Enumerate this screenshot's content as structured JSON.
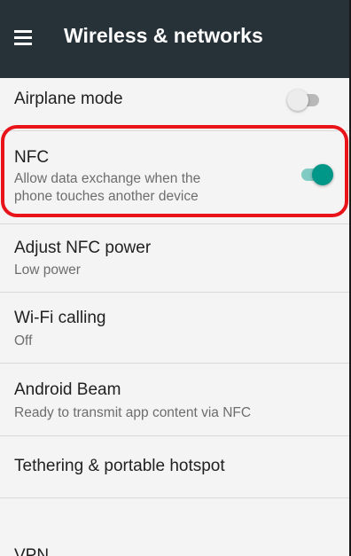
{
  "toolbar": {
    "title": "Wireless & networks",
    "menu_icon": "hamburger-menu-icon",
    "background": "#263238"
  },
  "items": [
    {
      "title": "Airplane mode",
      "summary": "",
      "toggle": "off"
    },
    {
      "title": "NFC",
      "summary_line1": "Allow data exchange when the",
      "summary_line2": "phone touches another device",
      "toggle": "on"
    },
    {
      "title": "Adjust NFC power",
      "summary": "Low power"
    },
    {
      "title": "Wi-Fi calling",
      "summary": "Off"
    },
    {
      "title": "Android Beam",
      "summary": "Ready to transmit app content via NFC"
    },
    {
      "title": "Tethering & portable hotspot",
      "summary": ""
    },
    {
      "title": "VPN",
      "summary": ""
    }
  ],
  "colors": {
    "accent": "#009688",
    "accent_track": "#80cbc4",
    "highlight": "#e8141a",
    "switch_off_thumb": "#ececec",
    "switch_off_track": "#b9b9b9"
  }
}
